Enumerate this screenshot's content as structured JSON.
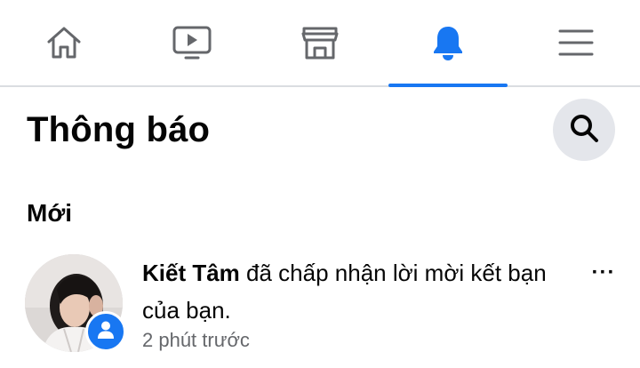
{
  "nav": {
    "tabs": [
      {
        "icon": "home-icon",
        "active": false
      },
      {
        "icon": "video-icon",
        "active": false
      },
      {
        "icon": "marketplace-icon",
        "active": false
      },
      {
        "icon": "bell-icon",
        "active": true
      },
      {
        "icon": "menu-icon",
        "active": false
      }
    ],
    "active_color": "#1877f2",
    "inactive_color": "#65676b"
  },
  "header": {
    "title": "Thông báo",
    "search_icon": "search-icon"
  },
  "section": {
    "label": "Mới"
  },
  "notifications": [
    {
      "name": "Kiết Tâm",
      "message": " đã chấp nhận lời mời kết bạn của bạn.",
      "time": "2 phút trước",
      "badge_icon": "person-icon",
      "more_icon": "more-horizontal-icon",
      "more_label": "···"
    }
  ]
}
